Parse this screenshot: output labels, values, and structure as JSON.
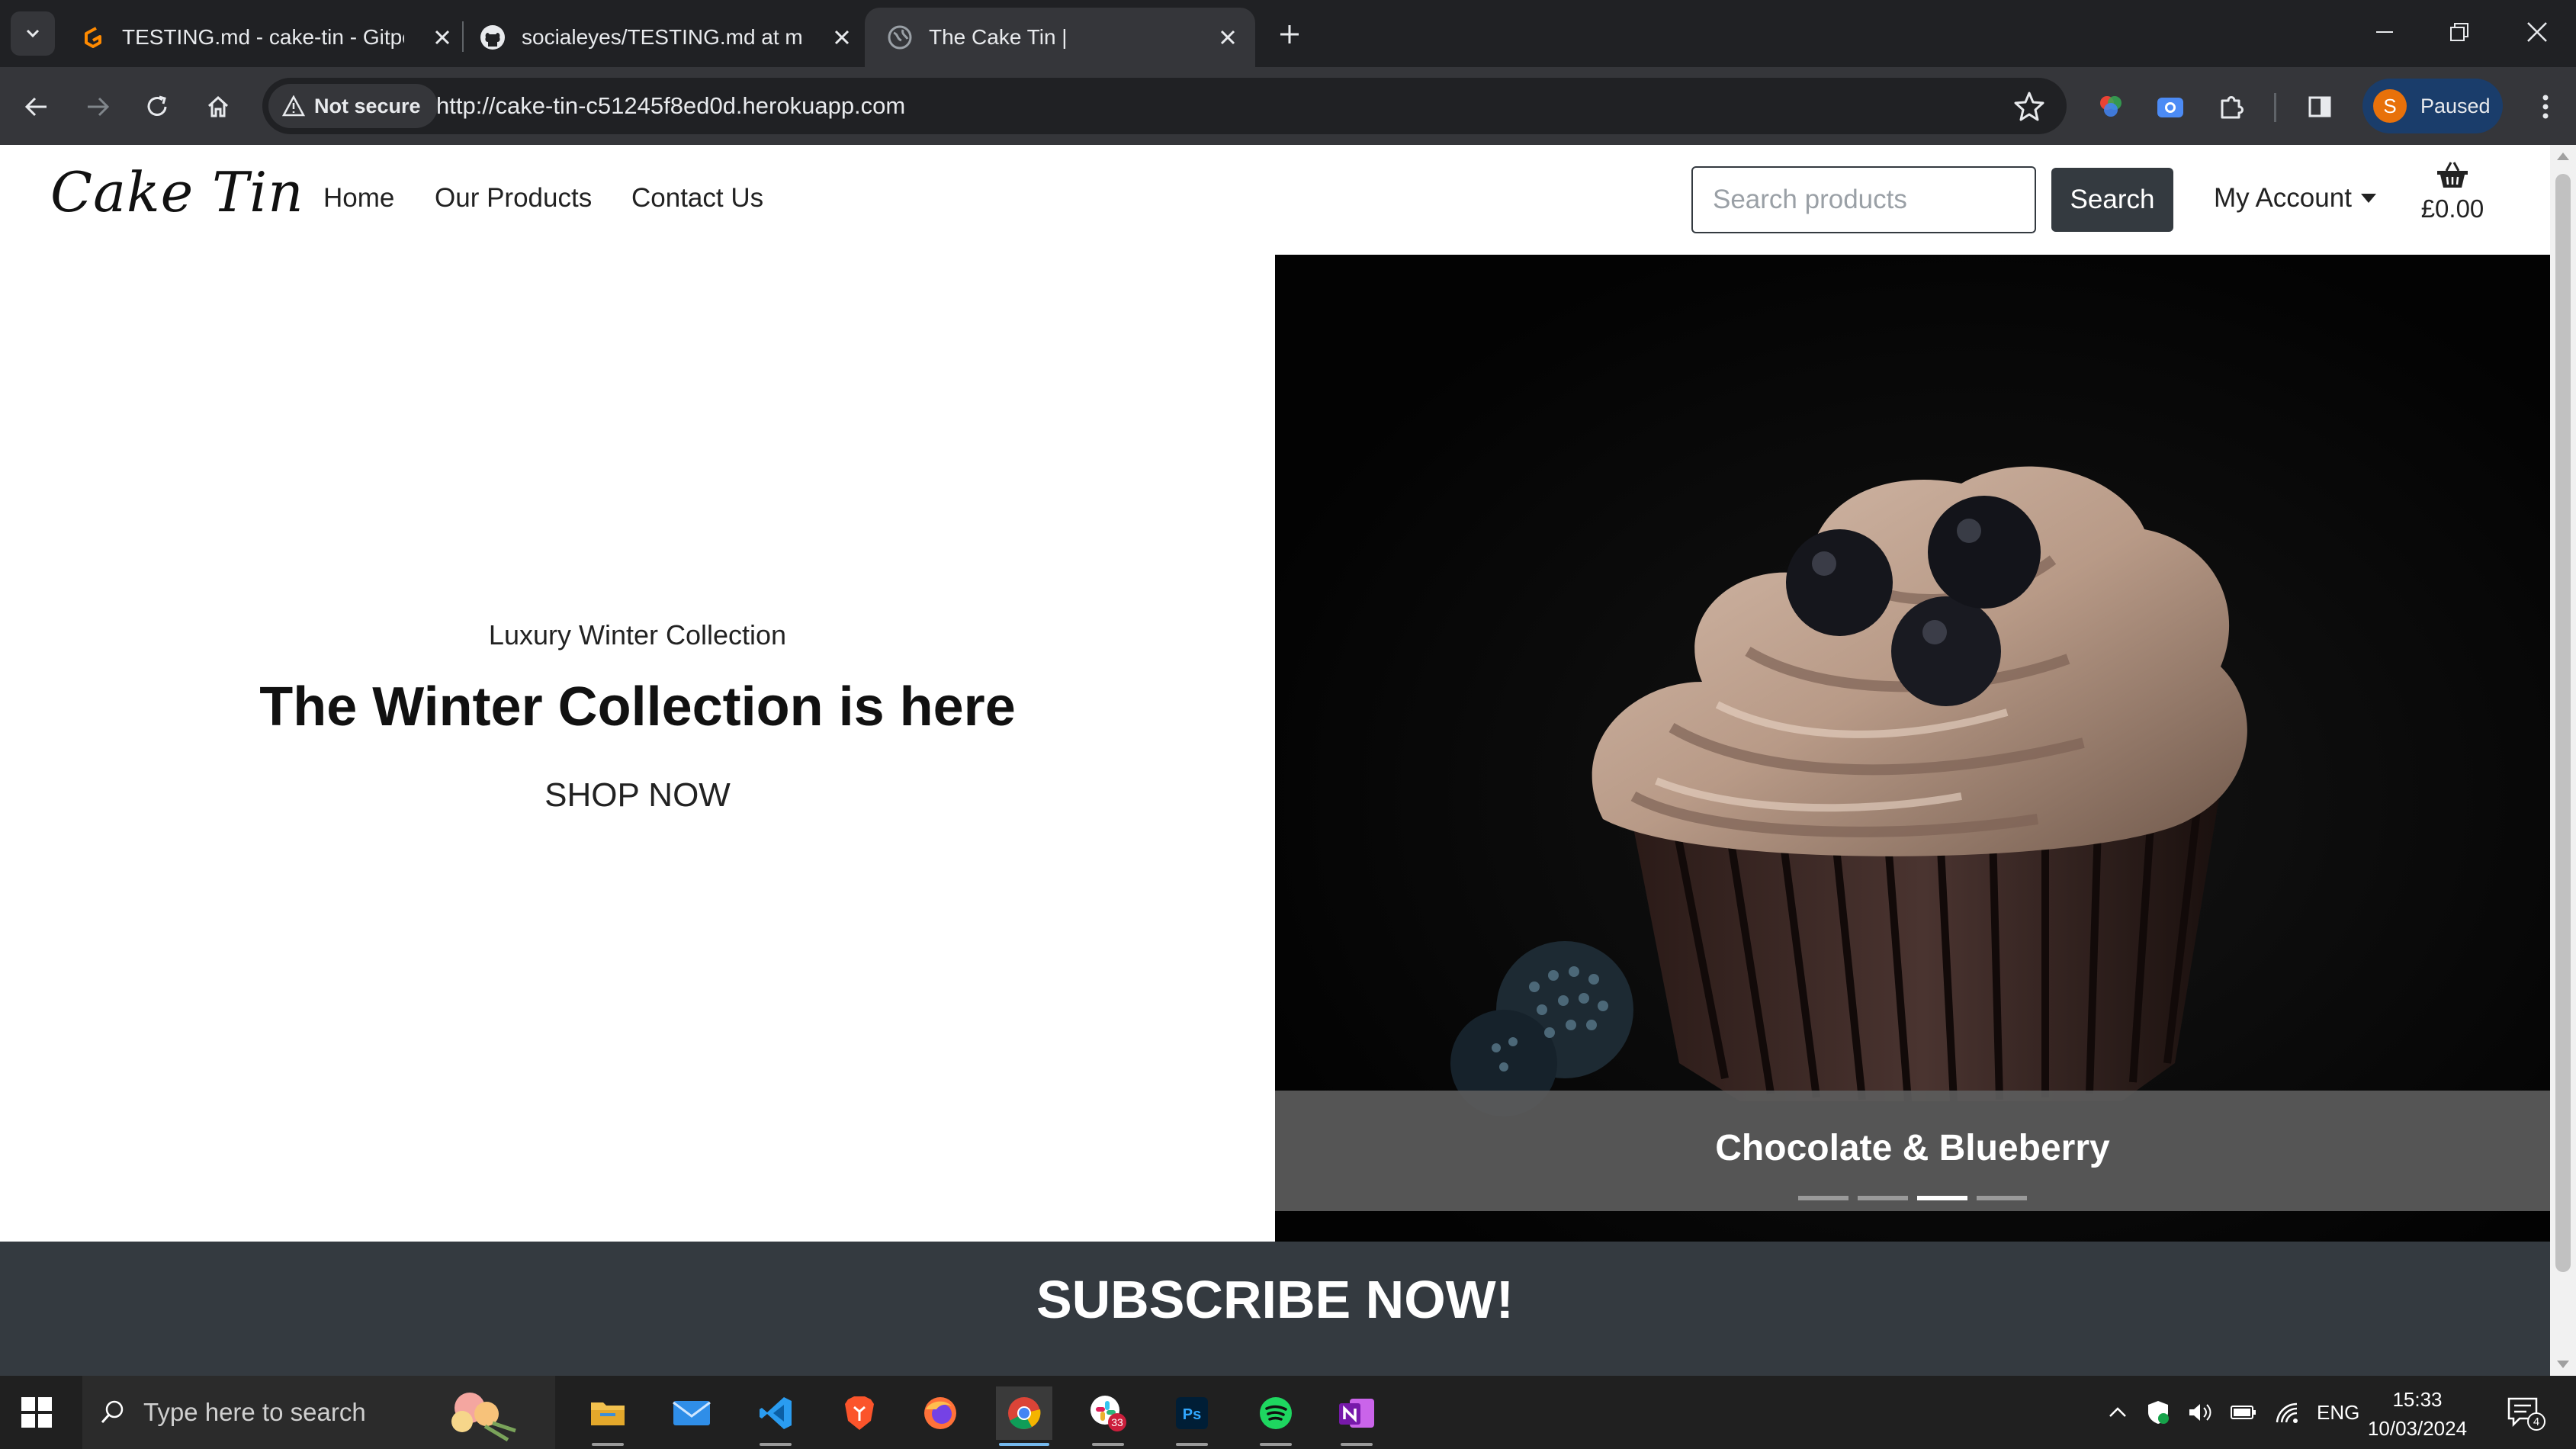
{
  "browser": {
    "tabs": [
      {
        "title": "TESTING.md - cake-tin - Gitpod",
        "icon": "gitpod-icon",
        "active": false
      },
      {
        "title": "socialeyes/TESTING.md at main",
        "icon": "github-icon",
        "active": false
      },
      {
        "title": "The Cake Tin |",
        "icon": "globe-icon",
        "active": true
      }
    ],
    "security_label": "Not secure",
    "url": "http://cake-tin-c51245f8ed0d.herokuapp.com",
    "profile_initial": "S",
    "profile_status": "Paused",
    "accent": "#e8710a"
  },
  "site": {
    "logo": "Cake Tin",
    "nav": [
      {
        "label": "Home"
      },
      {
        "label": "Our Products"
      },
      {
        "label": "Contact Us"
      }
    ],
    "search_placeholder": "Search products",
    "search_button": "Search",
    "account_label": "My Account",
    "basket_total": "£0.00",
    "dark_color": "#343a40"
  },
  "hero": {
    "eyebrow": "Luxury Winter Collection",
    "title": "The Winter Collection is here",
    "cta": "SHOP NOW"
  },
  "carousel": {
    "caption": "Chocolate & Blueberry",
    "slide_count": 4,
    "active_index": 2
  },
  "subscribe": {
    "title": "SUBSCRIBE NOW!"
  },
  "taskbar": {
    "search_placeholder": "Type here to search",
    "apps": [
      "file-explorer-icon",
      "mail-icon",
      "vscode-icon",
      "brave-icon",
      "firefox-icon",
      "chrome-icon",
      "slack-icon",
      "photoshop-icon",
      "spotify-icon",
      "onenote-icon"
    ],
    "slack_badge": "33",
    "language": "ENG",
    "time": "15:33",
    "date": "10/03/2024",
    "notification_count": "4"
  }
}
